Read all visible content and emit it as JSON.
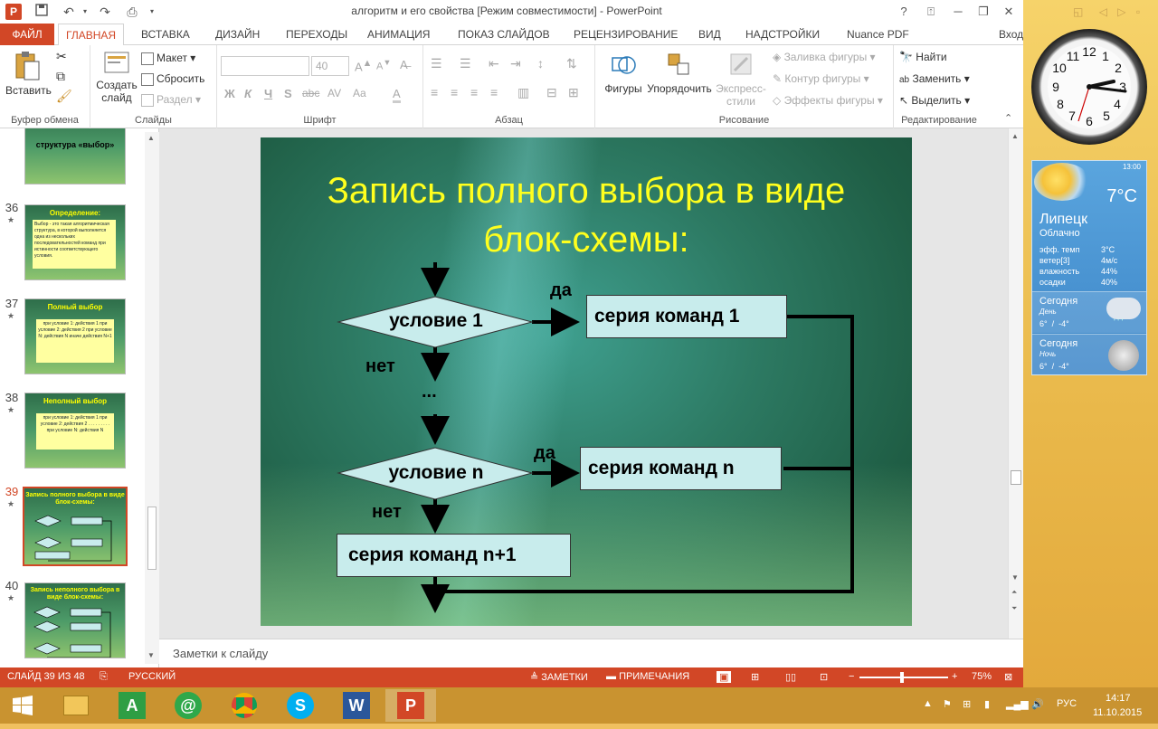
{
  "window": {
    "title": "алгоритм и его свойства [Режим совместимости] - PowerPoint",
    "help": "?",
    "minimize": "─",
    "restore": "❐",
    "close": "✕"
  },
  "tabs": [
    "ФАЙЛ",
    "ГЛАВНАЯ",
    "ВСТАВКА",
    "ДИЗАЙН",
    "ПЕРЕХОДЫ",
    "АНИМАЦИЯ",
    "ПОКАЗ СЛАЙДОВ",
    "РЕЦЕНЗИРОВАНИЕ",
    "ВИД",
    "НАДСТРОЙКИ",
    "Nuance PDF"
  ],
  "signin": "Вход",
  "ribbon": {
    "clipboard": {
      "paste": "Вставить",
      "label": "Буфер обмена"
    },
    "slides": {
      "new_slide": "Создать слайд",
      "layout": "Макет",
      "reset": "Сбросить",
      "section": "Раздел",
      "label": "Слайды"
    },
    "font": {
      "size": "40",
      "bold": "Ж",
      "italic": "К",
      "underline": "Ч",
      "shadow": "S",
      "strike": "abc",
      "spacing": "AV",
      "case": "Aa",
      "label": "Шрифт"
    },
    "paragraph": {
      "label": "Абзац"
    },
    "drawing": {
      "shapes": "Фигуры",
      "arrange": "Упорядочить",
      "quick_styles": "Экспресс-стили",
      "fill": "Заливка фигуры",
      "outline": "Контур фигуры",
      "effects": "Эффекты фигуры",
      "label": "Рисование"
    },
    "editing": {
      "find": "Найти",
      "replace": "Заменить",
      "select": "Выделить",
      "label": "Редактирование"
    }
  },
  "thumbnails": [
    {
      "num": "",
      "title": "структура «выбор»",
      "body": ""
    },
    {
      "num": "36",
      "title": "Определение:",
      "body": "Выбор - это такая алгоритмическая структура, в которой выполняется одна из нескольких последовательностей команд при истинности соответствующего условия."
    },
    {
      "num": "37",
      "title": "Полный выбор",
      "body": "при условие 1: действия 1 при условие 2: действия 2 при условие N: действия N иначе действия N+1"
    },
    {
      "num": "38",
      "title": "Неполный выбор",
      "body": "при условие 1: действия 1 при условие 2: действия 2 . . . . . . . . . при условие N: действия N"
    },
    {
      "num": "39",
      "title": "Запись полного выбора в виде блок-схемы:",
      "body": ""
    },
    {
      "num": "40",
      "title": "Запись неполного выбора в виде блок-схемы:",
      "body": ""
    }
  ],
  "slide": {
    "title_line1": "Запись полного выбора в виде",
    "title_line2": "блок-схемы:",
    "cond1": "условие 1",
    "condn": "условие n",
    "yes1": "да",
    "yesn": "да",
    "no1": "нет",
    "non": "нет",
    "dots": "...",
    "series1": "серия команд 1",
    "seriesn": "серия команд n",
    "seriesn1": "серия команд n+1"
  },
  "notes_placeholder": "Заметки к слайду",
  "status": {
    "slide_info": "СЛАЙД 39 ИЗ 48",
    "language": "РУССКИЙ",
    "notes": "ЗАМЕТКИ",
    "comments": "ПРИМЕЧАНИЯ",
    "zoom": "75%",
    "zoom_fraction": 0.48
  },
  "weather": {
    "time": "13:00",
    "temp": "7°C",
    "city": "Липецк",
    "condition": "Облачно",
    "feels_label": "эфф. темп",
    "feels_value": "3°C",
    "wind_label": "ветер[3]",
    "wind_value": "4м/с",
    "humidity_label": "влажность",
    "humidity_value": "44%",
    "precip_label": "осадки",
    "precip_value": "40%",
    "today_day": "Сегодня",
    "day_label": "День",
    "day_temps": "6°  /  -4°",
    "today_night": "Сегодня",
    "night_label": "Ночь",
    "night_temps": "6°  /  -4°"
  },
  "taskbar": {
    "lang": "РУС",
    "time": "14:17",
    "date": "11.10.2015"
  },
  "colors": {
    "accent": "#d24726",
    "slide_title": "#ffff1e",
    "box_fill": "#c8ecec"
  }
}
